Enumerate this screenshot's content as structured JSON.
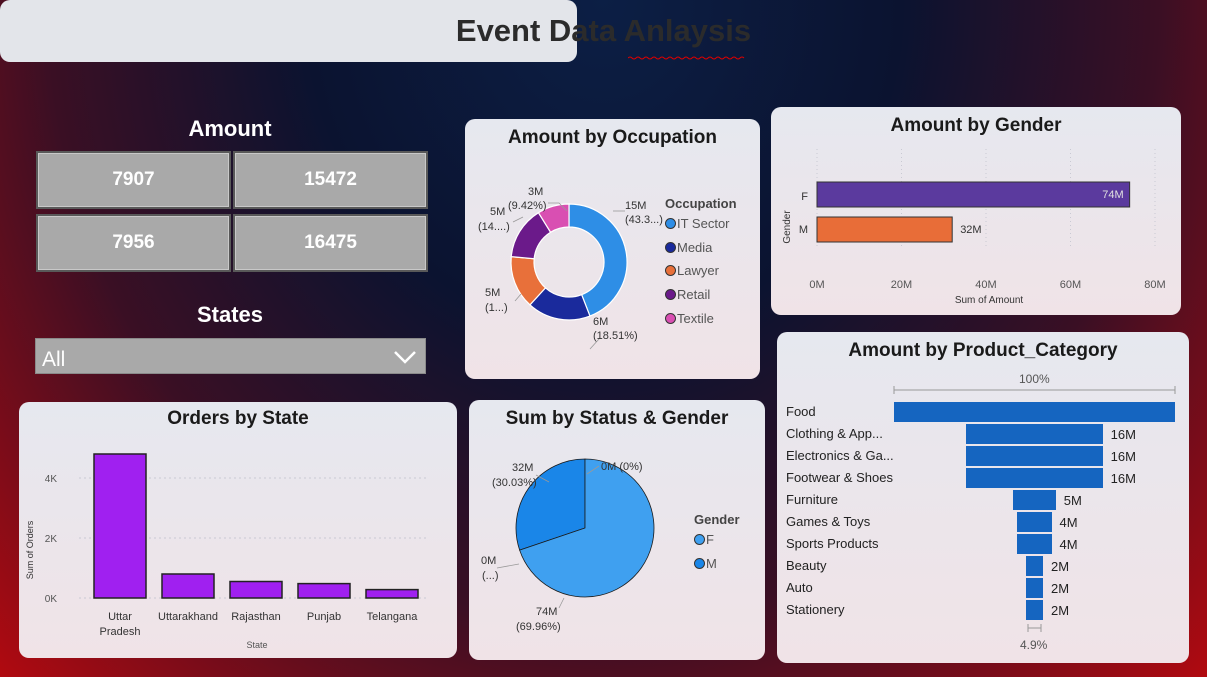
{
  "title": "Event  Data Anlaysis",
  "amount_section": {
    "label": "Amount",
    "cards": [
      "7907",
      "15472",
      "7956",
      "16475"
    ]
  },
  "states_section": {
    "label": "States",
    "selected": "All"
  },
  "occupation_chart": {
    "title": "Amount by Occupation",
    "legend_title": "Occupation",
    "legend": [
      "IT Sector",
      "Media",
      "Lawyer",
      "Retail",
      "Textile"
    ],
    "colors": [
      "#2e8ee6",
      "#1a2a9c",
      "#e8703a",
      "#6b1a8a",
      "#d94fb2"
    ],
    "labels": [
      {
        "v": "15M",
        "p": "(43.3...)"
      },
      {
        "v": "6M",
        "p": "(18.51%)"
      },
      {
        "v": "5M",
        "p": "(1...)"
      },
      {
        "v": "5M",
        "p": "(14....)"
      },
      {
        "v": "3M",
        "p": "(9.42%)"
      }
    ]
  },
  "gender_chart": {
    "title": "Amount by Gender",
    "ylabel": "Gender",
    "xlabel": "Sum of Amount",
    "categories": [
      "F",
      "M"
    ],
    "value_labels": [
      "74M",
      "32M"
    ],
    "colors": [
      "#5b3a9e",
      "#e86d38"
    ],
    "ticks": [
      "0M",
      "20M",
      "40M",
      "60M",
      "80M"
    ]
  },
  "product_chart": {
    "title": "Amount by Product_Category",
    "top_label": "100%",
    "bottom_label": "4.9%",
    "categories": [
      "Food",
      "Clothing & App...",
      "Electronics & Ga...",
      "Footwear & Shoes",
      "Furniture",
      "Games & Toys",
      "Sports Products",
      "Beauty",
      "Auto",
      "Stationery"
    ],
    "value_labels": [
      "",
      "16M",
      "16M",
      "16M",
      "5M",
      "4M",
      "4M",
      "2M",
      "2M",
      "2M"
    ]
  },
  "orders_chart": {
    "title": "Orders by State",
    "ylabel": "Sum of Orders",
    "xlabel": "State",
    "categories": [
      "Uttar Pradesh",
      "Uttarakhand",
      "Rajasthan",
      "Punjab",
      "Telangana"
    ],
    "ticks": [
      "0K",
      "2K",
      "4K"
    ],
    "color": "#a020f0"
  },
  "status_chart": {
    "title": "Sum by Status & Gender",
    "legend_title": "Gender",
    "legend": [
      "F",
      "M"
    ],
    "colors": [
      "#3fa0f0",
      "#1a86e8"
    ],
    "labels": [
      {
        "v": "32M",
        "p": "(30.03%)"
      },
      {
        "v": "0M (0%)",
        "p": ""
      },
      {
        "v": "0M",
        "p": "(...)"
      },
      {
        "v": "74M",
        "p": "(69.96%)"
      }
    ]
  },
  "chart_data": [
    {
      "type": "pie",
      "title": "Amount by Occupation",
      "categories": [
        "IT Sector",
        "Media",
        "Lawyer",
        "Retail",
        "Textile"
      ],
      "values": [
        15,
        6,
        5,
        5,
        3
      ],
      "percent": [
        43.3,
        18.51,
        14.5,
        14.2,
        9.42
      ],
      "unit": "M"
    },
    {
      "type": "bar",
      "title": "Amount by Gender",
      "orientation": "horizontal",
      "categories": [
        "F",
        "M"
      ],
      "values": [
        74,
        32
      ],
      "xlim": [
        0,
        80
      ],
      "unit": "M"
    },
    {
      "type": "bar",
      "title": "Amount by Product_Category",
      "orientation": "horizontal",
      "categories": [
        "Food",
        "Clothing & App...",
        "Electronics & Ga...",
        "Footwear & Shoes",
        "Furniture",
        "Games & Toys",
        "Sports Products",
        "Beauty",
        "Auto",
        "Stationery"
      ],
      "values": [
        33,
        16,
        16,
        16,
        5,
        4,
        4,
        2,
        2,
        2
      ],
      "unit": "M"
    },
    {
      "type": "bar",
      "title": "Orders by State",
      "categories": [
        "Uttar Pradesh",
        "Uttarakhand",
        "Rajasthan",
        "Punjab",
        "Telangana"
      ],
      "values": [
        4800,
        800,
        550,
        480,
        280
      ],
      "ylim": [
        0,
        5000
      ]
    },
    {
      "type": "pie",
      "title": "Sum by Status & Gender",
      "categories": [
        "M",
        "F"
      ],
      "values": [
        32,
        74
      ],
      "percent": [
        30.03,
        69.96
      ],
      "unit": "M"
    }
  ]
}
